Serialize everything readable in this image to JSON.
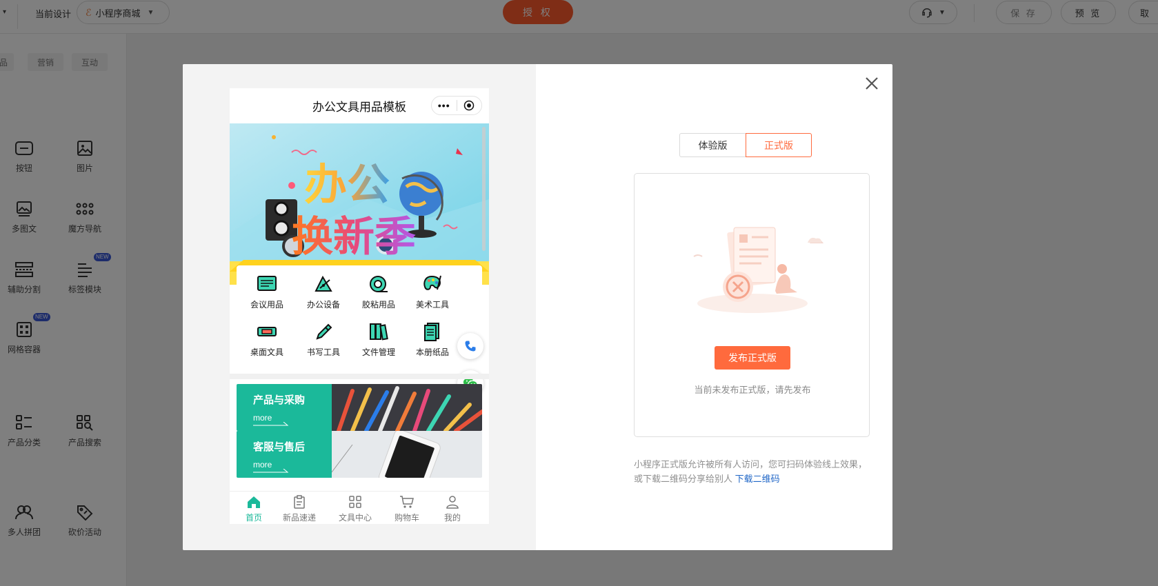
{
  "topbar": {
    "current_design_label": "当前设计",
    "project_name": "小程序商城",
    "auth_label": "授 权",
    "save_label": "保 存",
    "preview_label": "预 览",
    "cancel_label": "取"
  },
  "left_panel": {
    "chips": [
      "品",
      "营销",
      "互动"
    ],
    "components": [
      {
        "label": "按钮",
        "icon": "button-icon"
      },
      {
        "label": "图片",
        "icon": "image-icon"
      },
      {
        "label": "多图文",
        "icon": "multi-image-text-icon"
      },
      {
        "label": "魔方导航",
        "icon": "cube-nav-icon"
      },
      {
        "label": "辅助分割",
        "icon": "divider-icon"
      },
      {
        "label": "标签模块",
        "icon": "tag-module-icon",
        "badge": "NEW"
      },
      {
        "label": "网格容器",
        "icon": "grid-container-icon",
        "badge": "NEW"
      },
      {
        "label": "产品分类",
        "icon": "product-category-icon"
      },
      {
        "label": "产品搜索",
        "icon": "product-search-icon"
      },
      {
        "label": "多人拼团",
        "icon": "group-buy-icon"
      },
      {
        "label": "砍价活动",
        "icon": "bargain-icon"
      }
    ]
  },
  "modal": {
    "phone": {
      "title": "办公文具用品模板",
      "capsule_dots": "•••",
      "banner_line1": "办公",
      "banner_line2": "换新季",
      "categories": [
        {
          "label": "会议用品",
          "icon": "meeting-supplies-icon"
        },
        {
          "label": "办公设备",
          "icon": "office-equipment-icon"
        },
        {
          "label": "胶粘用品",
          "icon": "adhesive-tape-icon"
        },
        {
          "label": "美术工具",
          "icon": "art-palette-icon"
        },
        {
          "label": "桌面文具",
          "icon": "desk-stationery-icon"
        },
        {
          "label": "书写工具",
          "icon": "pencil-icon"
        },
        {
          "label": "文件管理",
          "icon": "file-binders-icon"
        },
        {
          "label": "本册纸品",
          "icon": "notebook-icon"
        }
      ],
      "promos": [
        {
          "title": "产品与采购",
          "more": "more"
        },
        {
          "title": "客服与售后",
          "more": "more"
        }
      ],
      "tabs": [
        {
          "label": "首页",
          "icon": "home-icon",
          "active": true
        },
        {
          "label": "新品速递",
          "icon": "clipboard-icon"
        },
        {
          "label": "文具中心",
          "icon": "grid-icon"
        },
        {
          "label": "购物车",
          "icon": "cart-icon"
        },
        {
          "label": "我的",
          "icon": "user-icon"
        }
      ]
    },
    "version_tabs": {
      "trial": "体验版",
      "official": "正式版",
      "selected": "正式版"
    },
    "publish_button": "发布正式版",
    "not_published_tip": "当前未发布正式版，请先发布",
    "description": "小程序正式版允许被所有人访问，您可扫码体验线上效果，或下载二维码分享给别人",
    "download_link": "下载二维码"
  },
  "colors": {
    "accent": "#ff6a3d",
    "auth_button": "#ff5a2c",
    "theme_green": "#1bb99a",
    "link_blue": "#1f66c7"
  }
}
